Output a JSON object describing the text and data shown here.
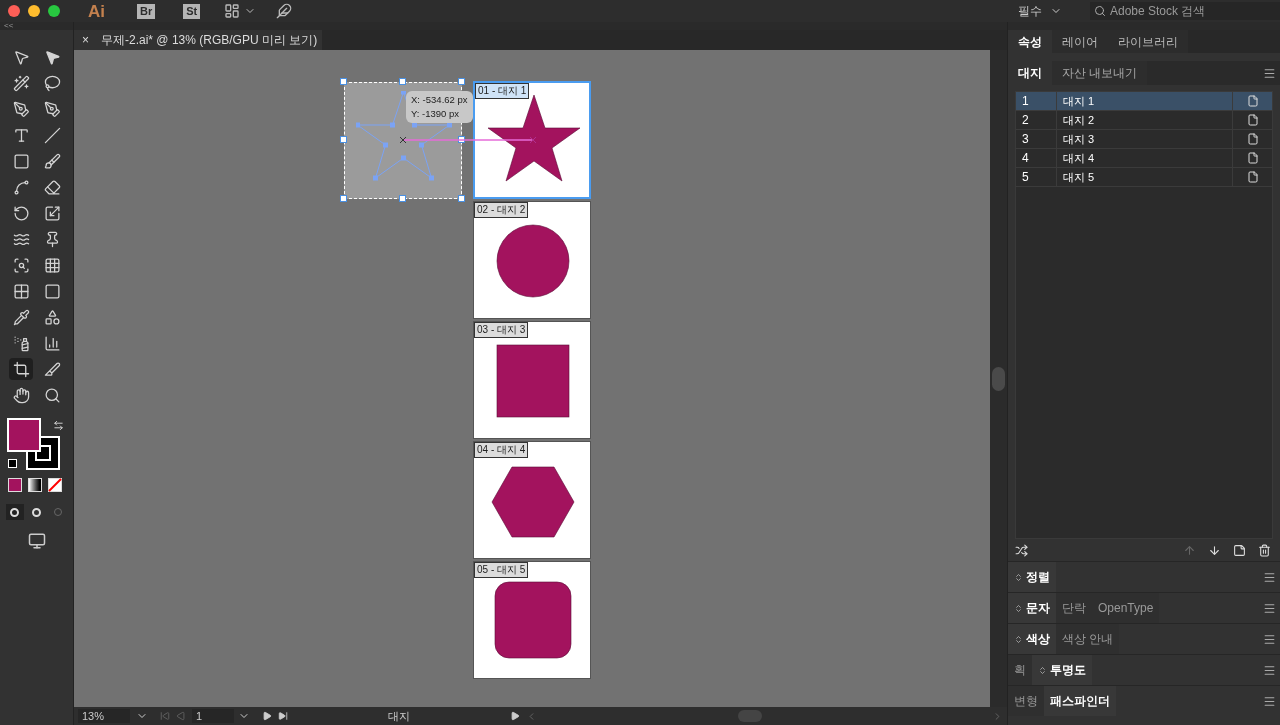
{
  "app_bar": {
    "logo": "Ai",
    "bridge": "Br",
    "stock": "St",
    "workspace": "필수",
    "search": {
      "placeholder": "Adobe Stock 검색"
    }
  },
  "collapse": "<<",
  "document_tab": {
    "close": "×",
    "title": "무제-2.ai* @ 13% (RGB/GPU 미리 보기)"
  },
  "tools": [
    {
      "kind": "selection",
      "selected": false
    },
    {
      "kind": "direct",
      "selected": false
    },
    {
      "kind": "wand",
      "selected": false
    },
    {
      "kind": "lasso",
      "selected": false
    },
    {
      "kind": "pen",
      "selected": false
    },
    {
      "kind": "curvature",
      "selected": false
    },
    {
      "kind": "type",
      "selected": false
    },
    {
      "kind": "line",
      "selected": false
    },
    {
      "kind": "rectangle",
      "selected": false
    },
    {
      "kind": "brush",
      "selected": false
    },
    {
      "kind": "shaper",
      "selected": false
    },
    {
      "kind": "eraser",
      "selected": false
    },
    {
      "kind": "rotate",
      "selected": false
    },
    {
      "kind": "scale",
      "selected": false
    },
    {
      "kind": "warp",
      "selected": false
    },
    {
      "kind": "pin",
      "selected": false
    },
    {
      "kind": "transform",
      "selected": false
    },
    {
      "kind": "perspective",
      "selected": false
    },
    {
      "kind": "mesh",
      "selected": false
    },
    {
      "kind": "gradient",
      "selected": false
    },
    {
      "kind": "eyedropper",
      "selected": false
    },
    {
      "kind": "blend",
      "selected": false
    },
    {
      "kind": "spray",
      "selected": false
    },
    {
      "kind": "graph",
      "selected": false
    },
    {
      "kind": "artboard",
      "selected": true
    },
    {
      "kind": "slice",
      "selected": false
    },
    {
      "kind": "hand",
      "selected": false
    },
    {
      "kind": "zoom",
      "selected": false
    }
  ],
  "canvas": {
    "tooltip": [
      "X: -534.62 px",
      "Y: -1390 px"
    ],
    "artboards": [
      {
        "label": "01 - 대지 1",
        "kind": "star",
        "selected": true
      },
      {
        "label": "02 - 대지 2",
        "kind": "circle",
        "selected": false
      },
      {
        "label": "03 - 대지 3",
        "kind": "square",
        "selected": false
      },
      {
        "label": "04 - 대지 4",
        "kind": "hexagon",
        "selected": false
      },
      {
        "label": "05 - 대지 5",
        "kind": "rounded",
        "selected": false
      }
    ]
  },
  "panel": {
    "tabs": [
      {
        "label": "속성",
        "selected": true
      },
      {
        "label": "레이어",
        "selected": false
      },
      {
        "label": "라이브러리",
        "selected": false
      }
    ],
    "subtabs": [
      {
        "label": "대지",
        "selected": true
      },
      {
        "label": "자산 내보내기",
        "selected": false
      }
    ],
    "artboards": [
      {
        "number": "1",
        "name": "대지 1",
        "selected": true
      },
      {
        "number": "2",
        "name": "대지 2",
        "selected": false
      },
      {
        "number": "3",
        "name": "대지 3",
        "selected": false
      },
      {
        "number": "4",
        "name": "대지 4",
        "selected": false
      },
      {
        "number": "5",
        "name": "대지 5",
        "selected": false
      }
    ],
    "sections": [
      [
        {
          "label": "정렬",
          "selected": true,
          "toggle": true
        }
      ],
      [
        {
          "label": "문자",
          "selected": true,
          "toggle": true
        },
        {
          "label": "단락",
          "selected": false,
          "toggle": false
        },
        {
          "label": "OpenType",
          "selected": false,
          "toggle": false
        }
      ],
      [
        {
          "label": "색상",
          "selected": true,
          "toggle": true
        },
        {
          "label": "색상 안내",
          "selected": false,
          "toggle": false
        }
      ],
      [
        {
          "label": "획",
          "selected": false,
          "toggle": false
        },
        {
          "label": "투명도",
          "selected": true,
          "toggle": true
        }
      ],
      [
        {
          "label": "변형",
          "selected": false,
          "toggle": false
        },
        {
          "label": "패스파인더",
          "selected": true,
          "toggle": false
        }
      ]
    ]
  },
  "status_bar": {
    "zoom": "13%",
    "page": "1",
    "mode": "대지"
  }
}
